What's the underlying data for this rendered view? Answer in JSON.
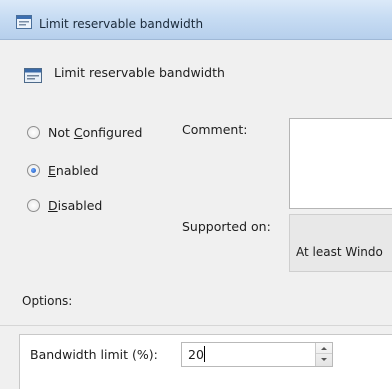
{
  "window": {
    "title": "Limit reservable bandwidth",
    "icon": "policy-setting-icon"
  },
  "header": {
    "title": "Limit reservable bandwidth",
    "icon": "policy-setting-icon"
  },
  "state": {
    "options": [
      {
        "prefix": "Not ",
        "accel": "C",
        "rest": "onfigured",
        "checked": false
      },
      {
        "prefix": "",
        "accel": "E",
        "rest": "nabled",
        "checked": true
      },
      {
        "prefix": "",
        "accel": "D",
        "rest": "isabled",
        "checked": false
      }
    ]
  },
  "comment": {
    "label": "Comment:",
    "value": ""
  },
  "supported": {
    "label": "Supported on:",
    "value": "At least Windo"
  },
  "options_section": {
    "label": "Options:",
    "bandwidth": {
      "label": "Bandwidth limit (%):",
      "value": "20"
    }
  },
  "colors": {
    "titlebar": "#c7dcf3",
    "background": "#f0f0f0",
    "radio_selected": "#1d56b8"
  }
}
